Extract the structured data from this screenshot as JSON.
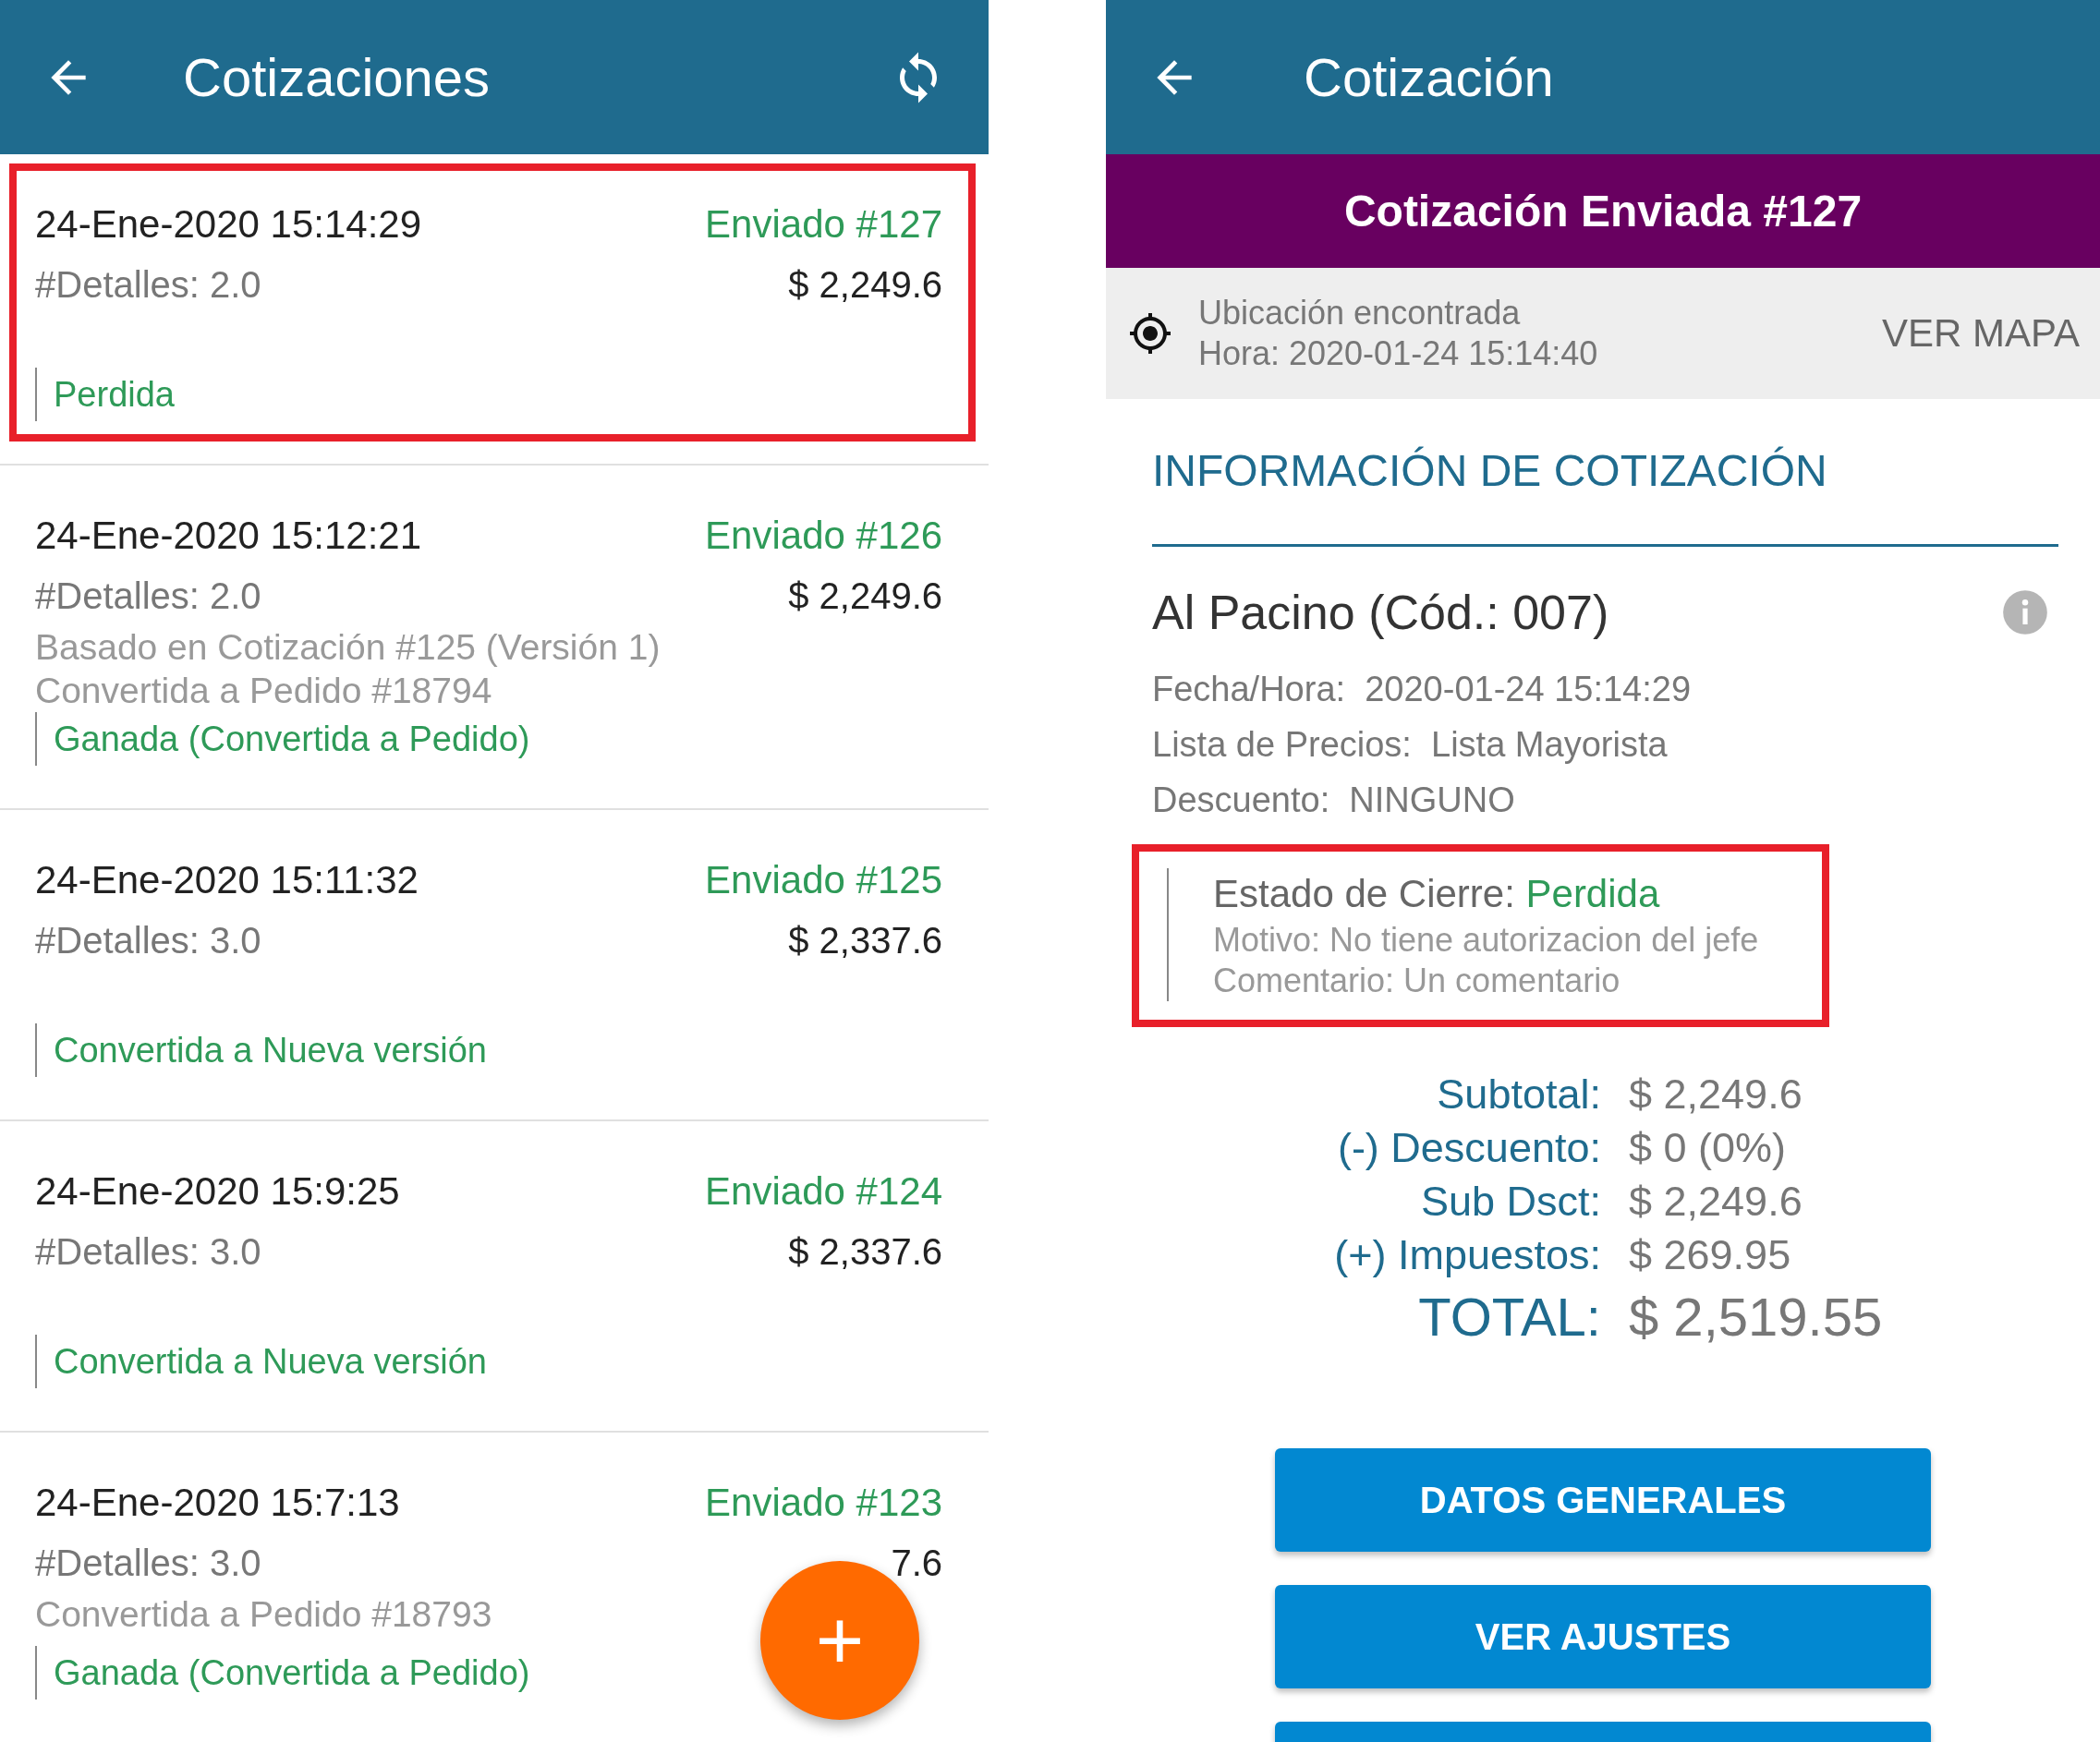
{
  "list_screen": {
    "title": "Cotizaciones",
    "items": [
      {
        "date": "24-Ene-2020 15:14:29",
        "status": "Enviado #127",
        "details": "#Detalles: 2.0",
        "amount": "$ 2,249.6",
        "outcome": "Perdida",
        "highlighted": true
      },
      {
        "date": "24-Ene-2020 15:12:21",
        "status": "Enviado #126",
        "details": "#Detalles: 2.0",
        "amount": "$ 2,249.6",
        "notes": [
          "Basado en Cotización #125 (Versión 1)",
          "Convertida a Pedido #18794"
        ],
        "outcome": "Ganada (Convertida a Pedido)",
        "highlighted": false
      },
      {
        "date": "24-Ene-2020 15:11:32",
        "status": "Enviado #125",
        "details": "#Detalles: 3.0",
        "amount": "$ 2,337.6",
        "outcome": "Convertida a Nueva versión",
        "highlighted": false
      },
      {
        "date": "24-Ene-2020 15:9:25",
        "status": "Enviado #124",
        "details": "#Detalles: 3.0",
        "amount": "$ 2,337.6",
        "outcome": "Convertida a Nueva versión",
        "highlighted": false
      },
      {
        "date": "24-Ene-2020 15:7:13",
        "status": "Enviado #123",
        "details": "#Detalles: 3.0",
        "amount": "7.6",
        "notes": [
          "Convertida a Pedido #18793"
        ],
        "outcome": "Ganada (Convertida a Pedido)",
        "highlighted": false
      }
    ],
    "fab": "+"
  },
  "detail_screen": {
    "title": "Cotización",
    "banner": "Cotización Enviada #127",
    "location": {
      "status": "Ubicación encontrada",
      "time": "Hora: 2020-01-24 15:14:40",
      "action": "VER MAPA"
    },
    "section_title": "INFORMACIÓN DE COTIZACIÓN",
    "client": "Al Pacino (Cód.: 007)",
    "fields": [
      {
        "label": "Fecha/Hora:",
        "value": "2020-01-24 15:14:29"
      },
      {
        "label": "Lista de Precios:",
        "value": "Lista Mayorista"
      },
      {
        "label": "Descuento:",
        "value": "NINGUNO"
      }
    ],
    "closing": {
      "label": "Estado de Cierre:",
      "value": "Perdida",
      "reason": "Motivo: No tiene autorizacion del jefe",
      "comment": "Comentario: Un comentario",
      "highlighted": true
    },
    "totals": [
      {
        "label": "Subtotal:",
        "value": "$ 2,249.6",
        "kind": "normal"
      },
      {
        "label": "(-) Descuento:",
        "value": "$ 0 (0%)",
        "kind": "normal"
      },
      {
        "label": "Sub Dsct:",
        "value": "$ 2,249.6",
        "kind": "normal"
      },
      {
        "label": "(+) Impuestos:",
        "value": "$ 269.95",
        "kind": "normal"
      },
      {
        "label": "TOTAL:",
        "value": "$ 2,519.55",
        "kind": "grand"
      }
    ],
    "buttons": [
      {
        "kind": "full",
        "label": "DATOS GENERALES"
      },
      {
        "kind": "full",
        "label": "VER AJUSTES"
      },
      {
        "kind": "cut"
      }
    ]
  }
}
